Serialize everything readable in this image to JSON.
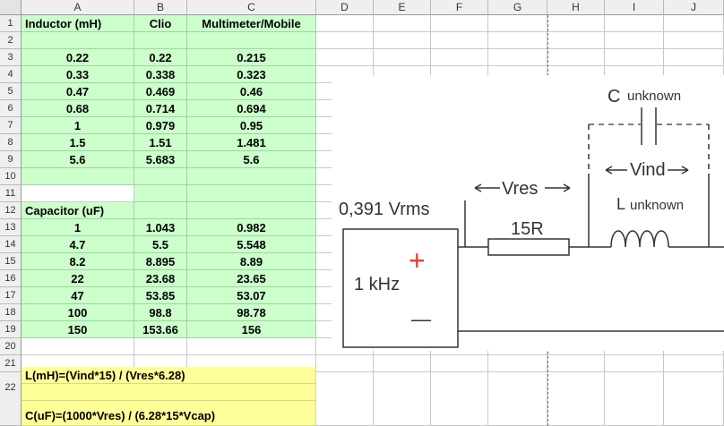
{
  "columns": [
    "A",
    "B",
    "C",
    "D",
    "E",
    "F",
    "G",
    "H",
    "I",
    "J"
  ],
  "rows": [
    "1",
    "2",
    "3",
    "4",
    "5",
    "6",
    "7",
    "8",
    "9",
    "10",
    "11",
    "12",
    "13",
    "14",
    "15",
    "16",
    "17",
    "18",
    "19",
    "20",
    "21",
    "22"
  ],
  "headers": {
    "a": "Inductor (mH)",
    "b": "Clio",
    "c": "Multimeter/Mobile"
  },
  "inductor_rows": [
    {
      "a": "0.22",
      "b": "0.22",
      "c": "0.215"
    },
    {
      "a": "0.33",
      "b": "0.338",
      "c": "0.323"
    },
    {
      "a": "0.47",
      "b": "0.469",
      "c": "0.46"
    },
    {
      "a": "0.68",
      "b": "0.714",
      "c": "0.694"
    },
    {
      "a": "1",
      "b": "0.979",
      "c": "0.95"
    },
    {
      "a": "1.5",
      "b": "1.51",
      "c": "1.481"
    },
    {
      "a": "5.6",
      "b": "5.683",
      "c": "5.6"
    }
  ],
  "capacitor_label": "Capacitor (uF)",
  "capacitor_rows": [
    {
      "a": "1",
      "b": "1.043",
      "c": "0.982"
    },
    {
      "a": "4.7",
      "b": "5.5",
      "c": "5.548"
    },
    {
      "a": "8.2",
      "b": "8.895",
      "c": "8.89"
    },
    {
      "a": "22",
      "b": "23.68",
      "c": "23.65"
    },
    {
      "a": "47",
      "b": "53.85",
      "c": "53.07"
    },
    {
      "a": "100",
      "b": "98.8",
      "c": "98.78"
    },
    {
      "a": "150",
      "b": "153.66",
      "c": "156"
    }
  ],
  "formulas": {
    "inductance": "L(mH)=(Vind*15) / (Vres*6.28)",
    "capacitance": "C(uF)=(1000*Vres) / (6.28*15*Vcap)"
  },
  "circuit": {
    "source_voltage": "0,391 Vrms",
    "frequency": "1 kHz",
    "plus": "+",
    "minus": "—",
    "resistor": "15R",
    "vres": "Vres",
    "vind": "Vind",
    "c_label": "C",
    "c_sub": "unknown",
    "l_label": "L",
    "l_sub": "unknown",
    "plus_color": "#e0403c"
  }
}
